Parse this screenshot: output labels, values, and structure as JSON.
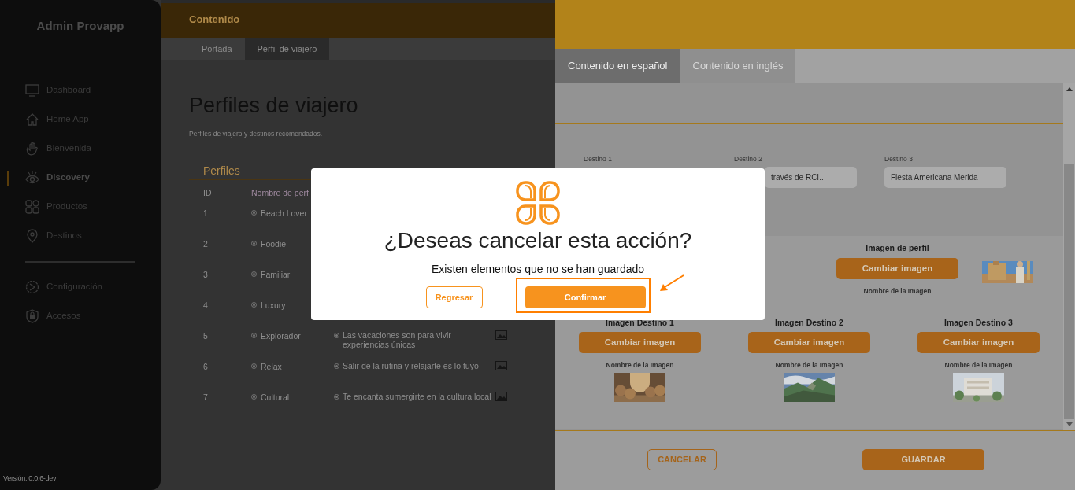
{
  "sidebar": {
    "title": "Admin Provapp",
    "items": [
      {
        "label": "Dashboard",
        "selected": false
      },
      {
        "label": "Home App",
        "selected": false
      },
      {
        "label": "Bienvenida",
        "selected": false
      },
      {
        "label": "Discovery",
        "selected": true
      },
      {
        "label": "Productos",
        "selected": false
      },
      {
        "label": "Destinos",
        "selected": false
      }
    ],
    "settings_items": [
      {
        "label": "Configuración",
        "selected": false
      },
      {
        "label": "Accesos",
        "selected": false
      }
    ],
    "version": "Versión: 0.0.6-dev"
  },
  "header": {
    "title": "Contenido"
  },
  "subtabs": [
    {
      "label": "Portada",
      "selected": false
    },
    {
      "label": "Perfil de viajero",
      "selected": true
    }
  ],
  "page": {
    "title": "Perfiles de viajero",
    "subtitle": "Perfiles de viajero y destinos recomendados.",
    "section": "Perfiles",
    "table": {
      "columns": [
        "ID",
        "Nombre de perf"
      ],
      "rows": [
        {
          "id": "1",
          "name": "Beach Lover"
        },
        {
          "id": "2",
          "name": "Foodie"
        },
        {
          "id": "3",
          "name": "Familiar"
        },
        {
          "id": "4",
          "name": "Luxury"
        },
        {
          "id": "5",
          "name": "Explorador",
          "description": "Las vacaciones son para vivir experiencias únicas"
        },
        {
          "id": "6",
          "name": "Relax",
          "description": "Salir de la rutina y relajarte es lo tuyo"
        },
        {
          "id": "7",
          "name": "Cultural",
          "description": "Te encanta sumergirte en la cultura local"
        }
      ]
    }
  },
  "panel": {
    "tabs": [
      {
        "label": "Contenido en español",
        "selected": true
      },
      {
        "label": "Contenido en inglés",
        "selected": false
      }
    ],
    "destinations": [
      {
        "label": "Destino 1"
      },
      {
        "label": "Destino 2",
        "value": "través de RCI.."
      },
      {
        "label": "Destino 3",
        "value": "Fiesta Americana Merida"
      }
    ],
    "profile_image": {
      "label": "Imagen de perfil",
      "button": "Cambiar imagen",
      "caption": "Nombre de la Imagen"
    },
    "destination_images": [
      {
        "label": "Imagen Destino 1",
        "button": "Cambiar imagen",
        "caption": "Nombre de la Imagen"
      },
      {
        "label": "Imagen Destino 2",
        "button": "Cambiar imagen",
        "caption": "Nombre de la Imagen"
      },
      {
        "label": "Imagen Destino 3",
        "button": "Cambiar imagen",
        "caption": "Nombre de la Imagen"
      }
    ],
    "footer_buttons": [
      {
        "label": "CANCELAR",
        "kind": "outline"
      },
      {
        "label": "GUARDAR",
        "kind": "primary"
      }
    ]
  },
  "dialog": {
    "title": "¿Deseas cancelar esta acción?",
    "message": "Existen elementos que no se han guardado",
    "buttons": [
      {
        "label": "Regresar",
        "kind": "outline",
        "highlighted": false
      },
      {
        "label": "Confirmar",
        "kind": "primary",
        "highlighted": true
      }
    ]
  }
}
